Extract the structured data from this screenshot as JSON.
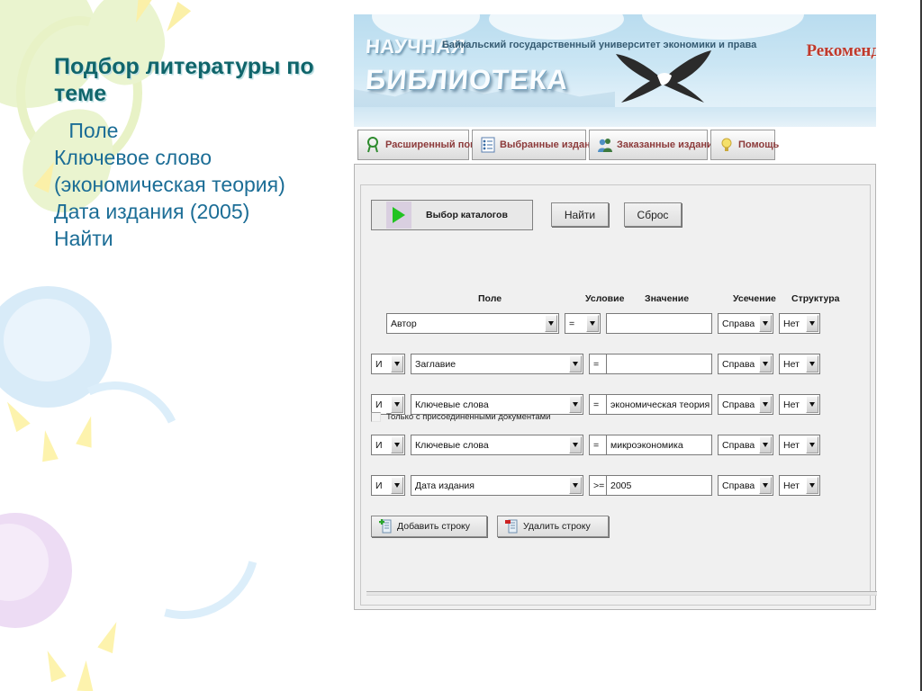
{
  "slide": {
    "title": "Подбор литературы по теме",
    "bullets": [
      " Поле",
      "Ключевое слово (экономическая теория)",
      "Дата издания (2005)",
      "Найти"
    ]
  },
  "banner": {
    "word1": "НАУЧНАЯ",
    "word2": "БИБЛИОТЕКА",
    "university": "Байкальский государственный университет экономики и права",
    "recommend": "Рекоменд",
    "colors": {
      "sky": "#cbe6f4",
      "title_text": "#fafdff",
      "recommend_text": "#c0392b"
    }
  },
  "tabs": [
    {
      "label": "Расширенный поиск",
      "icon": "magnifier-icon"
    },
    {
      "label": "Выбранные издания",
      "icon": "checklist-icon"
    },
    {
      "label": "Заказанные издания",
      "icon": "people-icon"
    },
    {
      "label": "Помощь",
      "icon": "lightbulb-icon"
    }
  ],
  "toolbar": {
    "catalog_button": "Выбор каталогов",
    "find_button": "Найти",
    "reset_button": "Сброс"
  },
  "table": {
    "headers": {
      "field": "Поле",
      "condition": "Условие",
      "value": "Значение",
      "truncation": "Усечение",
      "structure": "Структура"
    },
    "rows": [
      {
        "bool": "",
        "field": "Автор",
        "condition": "=",
        "value": "",
        "truncation": "Справа",
        "structure": "Нет"
      },
      {
        "bool": "И",
        "field": "Заглавие",
        "condition": "=",
        "value": "",
        "truncation": "Справа",
        "structure": "Нет"
      },
      {
        "bool": "И",
        "field": "Ключевые слова",
        "condition": "=",
        "value": "экономическая теория",
        "truncation": "Справа",
        "structure": "Нет"
      },
      {
        "bool": "И",
        "field": "Ключевые слова",
        "condition": "=",
        "value": "микроэкономика",
        "truncation": "Справа",
        "structure": "Нет"
      },
      {
        "bool": "И",
        "field": "Дата издания",
        "condition": ">=",
        "value": "2005",
        "truncation": "Справа",
        "structure": "Нет"
      }
    ]
  },
  "actions": {
    "add_row": "Добавить строку",
    "delete_row": "Удалить строку"
  },
  "checkbox": {
    "label": "Только с присоединенными документами",
    "checked": false
  }
}
